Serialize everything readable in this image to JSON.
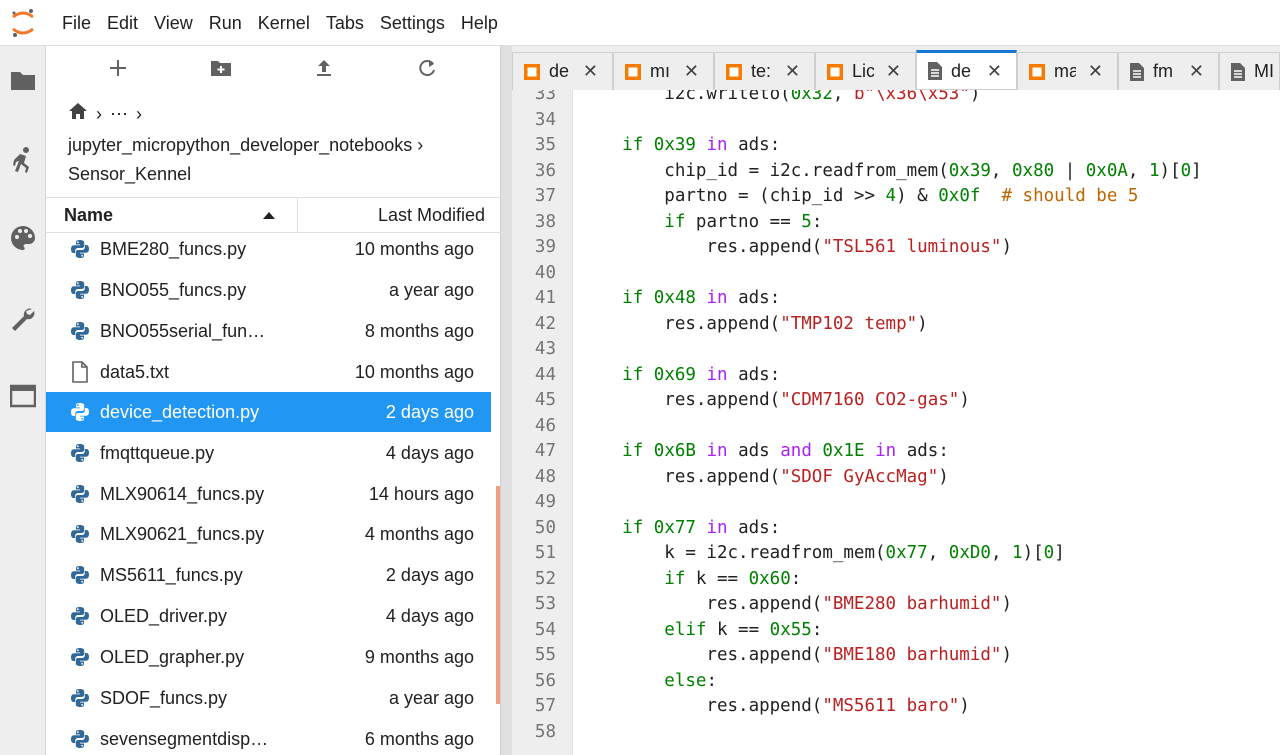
{
  "menubar": {
    "items": [
      "File",
      "Edit",
      "View",
      "Run",
      "Kernel",
      "Tabs",
      "Settings",
      "Help"
    ]
  },
  "activity_bar": {
    "icons": [
      "folder-icon",
      "running-icon",
      "palette-icon",
      "wrench-icon",
      "tabs-icon"
    ]
  },
  "filebrowser": {
    "toolbar_icons": [
      "plus-icon",
      "new-folder-icon",
      "upload-icon",
      "refresh-icon"
    ],
    "breadcrumb": {
      "ellipsis": "⋯",
      "path_line1": "jupyter_micropython_developer_notebooks",
      "path_line2": "Sensor_Kennel"
    },
    "header": {
      "name": "Name",
      "modified": "Last Modified"
    },
    "files": [
      {
        "name": "BME280_funcs.py",
        "modified": "10 months ago",
        "type": "python"
      },
      {
        "name": "BNO055_funcs.py",
        "modified": "a year ago",
        "type": "python"
      },
      {
        "name": "BNO055serial_fun…",
        "modified": "8 months ago",
        "type": "python"
      },
      {
        "name": "data5.txt",
        "modified": "10 months ago",
        "type": "text"
      },
      {
        "name": "device_detection.py",
        "modified": "2 days ago",
        "type": "python",
        "selected": true
      },
      {
        "name": "fmqttqueue.py",
        "modified": "4 days ago",
        "type": "python"
      },
      {
        "name": "MLX90614_funcs.py",
        "modified": "14 hours ago",
        "type": "python"
      },
      {
        "name": "MLX90621_funcs.py",
        "modified": "4 months ago",
        "type": "python"
      },
      {
        "name": "MS5611_funcs.py",
        "modified": "2 days ago",
        "type": "python"
      },
      {
        "name": "OLED_driver.py",
        "modified": "4 days ago",
        "type": "python"
      },
      {
        "name": "OLED_grapher.py",
        "modified": "9 months ago",
        "type": "python"
      },
      {
        "name": "SDOF_funcs.py",
        "modified": "a year ago",
        "type": "python"
      },
      {
        "name": "sevensegmentdisp…",
        "modified": "6 months ago",
        "type": "python"
      }
    ]
  },
  "tabs": [
    {
      "label": "de",
      "type": "notebook"
    },
    {
      "label": "mı",
      "type": "notebook"
    },
    {
      "label": "te:",
      "type": "notebook"
    },
    {
      "label": "Lic",
      "type": "notebook"
    },
    {
      "label": "de",
      "type": "file",
      "active": true
    },
    {
      "label": "ma",
      "type": "notebook"
    },
    {
      "label": "fm",
      "type": "file"
    },
    {
      "label": "MI",
      "type": "file"
    }
  ],
  "editor": {
    "lines": [
      {
        "n": "33",
        "html": "    i2c.writeto(<span class=\"num\">0x32</span>, <span class=\"str\">b\"\\x36\\x53\"</span>)"
      },
      {
        "n": "34",
        "html": ""
      },
      {
        "n": "35",
        "html": "<span class=\"kw\">if</span> <span class=\"num\">0x39</span> <span class=\"kw2\">in</span> ads:"
      },
      {
        "n": "36",
        "html": "    chip_id = i2c.readfrom_mem(<span class=\"num\">0x39</span>, <span class=\"num\">0x80</span> | <span class=\"num\">0x0A</span>, <span class=\"num\">1</span>)[<span class=\"num\">0</span>]"
      },
      {
        "n": "37",
        "html": "    partno = (chip_id >> <span class=\"num\">4</span>) &amp; <span class=\"num\">0x0f</span>  <span class=\"cmt\"># should be 5</span>"
      },
      {
        "n": "38",
        "html": "    <span class=\"kw\">if</span> partno == <span class=\"num\">5</span>:"
      },
      {
        "n": "39",
        "html": "        res.append(<span class=\"str\">\"TSL561 luminous\"</span>)"
      },
      {
        "n": "40",
        "html": ""
      },
      {
        "n": "41",
        "html": "<span class=\"kw\">if</span> <span class=\"num\">0x48</span> <span class=\"kw2\">in</span> ads:"
      },
      {
        "n": "42",
        "html": "    res.append(<span class=\"str\">\"TMP102 temp\"</span>)"
      },
      {
        "n": "43",
        "html": ""
      },
      {
        "n": "44",
        "html": "<span class=\"kw\">if</span> <span class=\"num\">0x69</span> <span class=\"kw2\">in</span> ads:"
      },
      {
        "n": "45",
        "html": "    res.append(<span class=\"str\">\"CDM7160 CO2-gas\"</span>)"
      },
      {
        "n": "46",
        "html": ""
      },
      {
        "n": "47",
        "html": "<span class=\"kw\">if</span> <span class=\"num\">0x6B</span> <span class=\"kw2\">in</span> ads <span class=\"kw2\">and</span> <span class=\"num\">0x1E</span> <span class=\"kw2\">in</span> ads:"
      },
      {
        "n": "48",
        "html": "    res.append(<span class=\"str\">\"SDOF GyAccMag\"</span>)"
      },
      {
        "n": "49",
        "html": ""
      },
      {
        "n": "50",
        "html": "<span class=\"kw\">if</span> <span class=\"num\">0x77</span> <span class=\"kw2\">in</span> ads:"
      },
      {
        "n": "51",
        "html": "    k = i2c.readfrom_mem(<span class=\"num\">0x77</span>, <span class=\"num\">0xD0</span>, <span class=\"num\">1</span>)[<span class=\"num\">0</span>]"
      },
      {
        "n": "52",
        "html": "    <span class=\"kw\">if</span> k == <span class=\"num\">0x60</span>:"
      },
      {
        "n": "53",
        "html": "        res.append(<span class=\"str\">\"BME280 barhumid\"</span>)"
      },
      {
        "n": "54",
        "html": "    <span class=\"kw\">elif</span> k == <span class=\"num\">0x55</span>:"
      },
      {
        "n": "55",
        "html": "        res.append(<span class=\"str\">\"BME180 barhumid\"</span>)"
      },
      {
        "n": "56",
        "html": "    <span class=\"kw\">else</span>:"
      },
      {
        "n": "57",
        "html": "        res.append(<span class=\"str\">\"MS5611 baro\"</span>)"
      },
      {
        "n": "58",
        "html": ""
      }
    ]
  }
}
